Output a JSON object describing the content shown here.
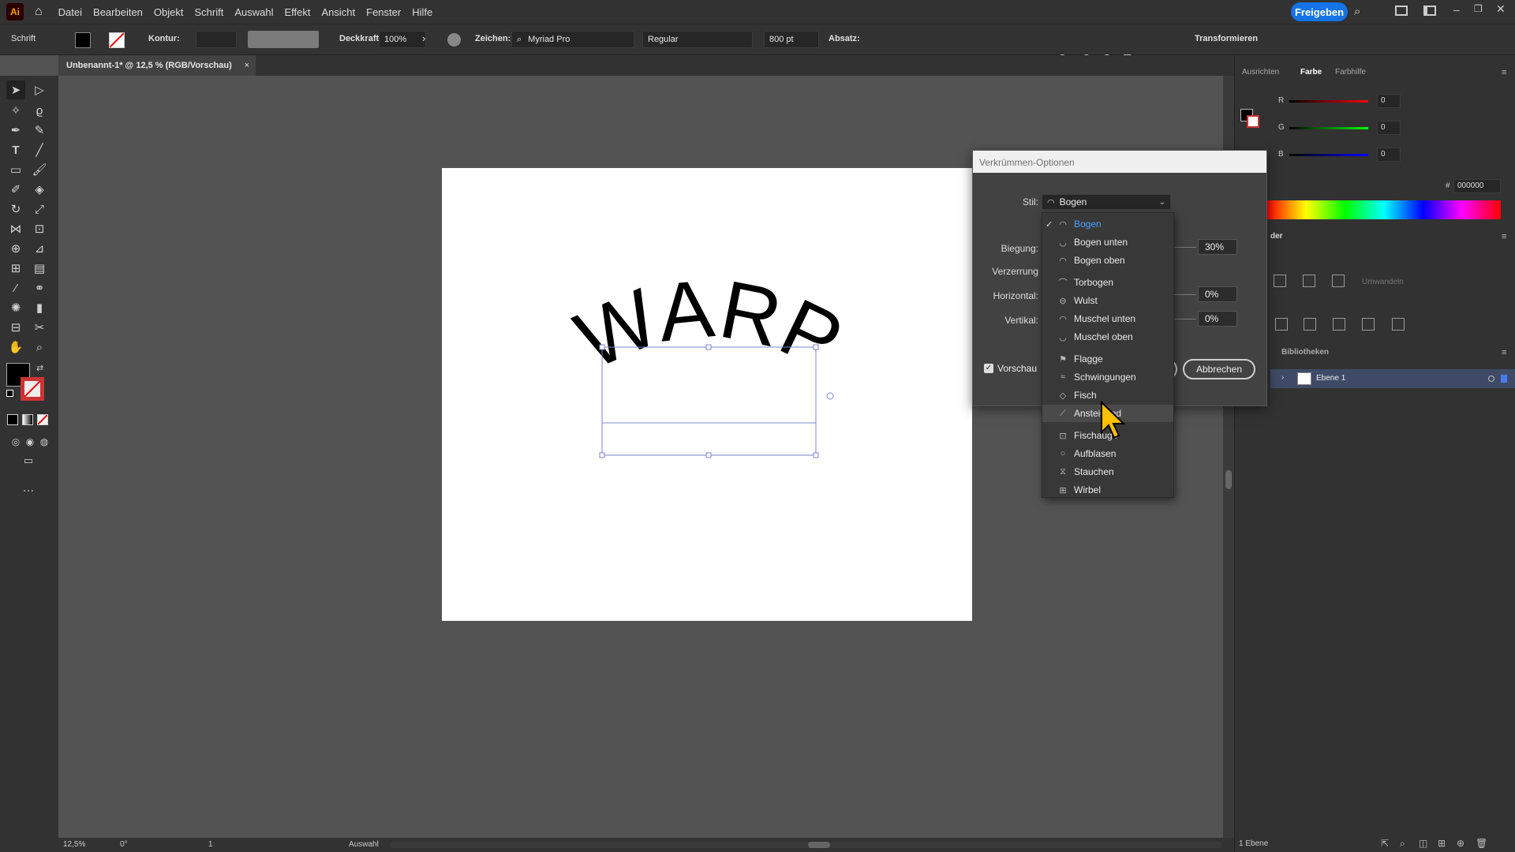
{
  "app": {
    "logo": "Ai",
    "share_label": "Freigeben"
  },
  "menu": [
    "Datei",
    "Bearbeiten",
    "Objekt",
    "Schrift",
    "Auswahl",
    "Effekt",
    "Ansicht",
    "Fenster",
    "Hilfe"
  ],
  "control_bar": {
    "context": "Schrift",
    "stroke_label": "Kontur:",
    "opacity_label": "Deckkraft:",
    "opacity_value": "100%",
    "char_label": "Zeichen:",
    "font_family": "Myriad Pro",
    "font_style": "Regular",
    "font_size": "800 pt",
    "paragraph_label": "Absatz:",
    "transform_label": "Transformieren"
  },
  "document": {
    "tab_title": "Unbenannt-1* @ 12,5 % (RGB/Vorschau)",
    "close": "×"
  },
  "canvas": {
    "text": "WARP"
  },
  "status": {
    "zoom": "12,5%",
    "rotation": "0°",
    "page": "1",
    "tool": "Auswahl"
  },
  "right_panel": {
    "tabs": [
      "Ausrichten",
      "Farbe",
      "Farbhilfe"
    ],
    "active_tab": "Farbe",
    "r_label": "R",
    "g_label": "G",
    "b_label": "B",
    "r_value": "0",
    "g_value": "0",
    "b_value": "0",
    "hex_label": "#",
    "hex_value": "000000",
    "libraries_label": "Bibliotheken",
    "layer_name": "Ebene 1",
    "layers_count": "1 Ebene",
    "pathfinder_label": "der",
    "apply_label": "Umwandeln"
  },
  "dialog": {
    "title": "Verkrümmen-Optionen",
    "style_label": "Stil:",
    "style_value": "Bogen",
    "bend_label": "Biegung:",
    "bend_value": "30%",
    "distortion_label": "Verzerrung",
    "horizontal_label": "Horizontal:",
    "horizontal_value": "0%",
    "vertical_label": "Vertikal:",
    "vertical_value": "0%",
    "preview_label": "Vorschau",
    "cancel_label": "Abbrechen"
  },
  "dropdown_items": [
    {
      "label": "Bogen",
      "selected": true
    },
    {
      "label": "Bogen unten"
    },
    {
      "label": "Bogen oben"
    },
    {
      "label": "Torbogen"
    },
    {
      "label": "Wulst"
    },
    {
      "label": "Muschel unten"
    },
    {
      "label": "Muschel oben"
    },
    {
      "label": "Flagge"
    },
    {
      "label": "Schwingungen"
    },
    {
      "label": "Fisch"
    },
    {
      "label": "Ansteigend",
      "hover": true
    },
    {
      "label": "Fischauge"
    },
    {
      "label": "Aufblasen"
    },
    {
      "label": "Stauchen"
    },
    {
      "label": "Wirbel"
    }
  ],
  "colors": {
    "accent": "#1473e6",
    "selection": "#4aa3ff",
    "bbox": "#7b86c8"
  }
}
